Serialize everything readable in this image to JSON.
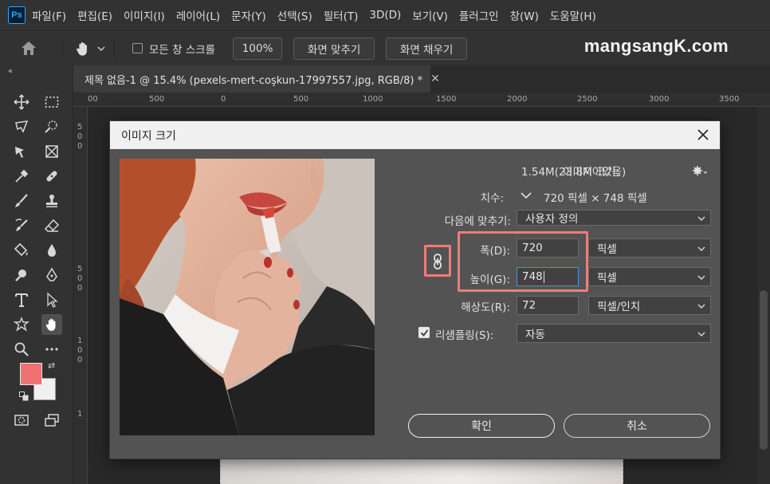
{
  "menubar": {
    "app_badge": "Ps",
    "items": [
      "파일(F)",
      "편집(E)",
      "이미지(I)",
      "레이어(L)",
      "문자(Y)",
      "선택(S)",
      "필터(T)",
      "3D(D)",
      "보기(V)",
      "플러그인",
      "창(W)",
      "도움말(H)"
    ]
  },
  "options": {
    "scroll_all_label": "모든 창 스크롤",
    "zoom_value": "100%",
    "fit_screen_label": "화면 맞추기",
    "fill_screen_label": "화면 채우기"
  },
  "watermark": "mangsangK.com",
  "document": {
    "tab_title": "제목 없음-1 @ 15.4% (pexels-mert-coşkun-17997557.jpg, RGB/8) *",
    "ruler_top": [
      "00",
      "500",
      "0",
      "500",
      "1000",
      "1500",
      "2000",
      "2500",
      "3000",
      "3500"
    ],
    "ruler_left": [
      "5",
      "0",
      "0",
      "5",
      "0",
      "0",
      "1",
      "0",
      "0",
      "1"
    ]
  },
  "toolbar": {
    "foreground_color": "#f07171",
    "background_color": "#f0f0f0"
  },
  "dialog": {
    "title": "이미지 크기",
    "image_size_label": "이미지 크기:",
    "image_size_value": "1.54M(23.8M이었음)",
    "dimensions_label": "치수:",
    "dimensions_value": "720 픽셀  ×  748 픽셀",
    "fit_to_label": "다음에 맞추기:",
    "fit_to_value": "사용자 정의",
    "width_label": "폭(D):",
    "width_value": "720",
    "width_unit": "픽셀",
    "height_label": "높이(G):",
    "height_value": "748",
    "height_unit": "픽셀",
    "resolution_label": "해상도(R):",
    "resolution_value": "72",
    "resolution_unit": "픽셀/인치",
    "resample_label": "리샘플링(S):",
    "resample_checked": true,
    "resample_value": "자동",
    "ok_label": "확인",
    "cancel_label": "취소",
    "highlight_color": "#f07b7b"
  }
}
